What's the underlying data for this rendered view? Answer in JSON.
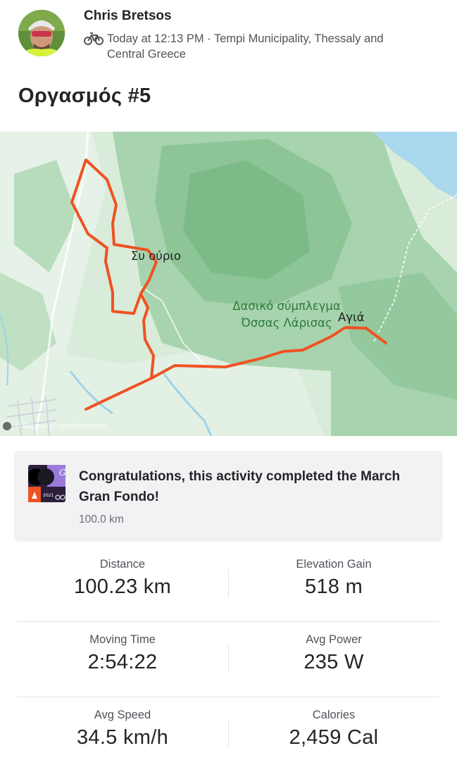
{
  "athlete": {
    "name": "Chris Bretsos",
    "timestamp": "Today at 12:13 PM",
    "location": "Tempi Municipality, Thessaly and Central Greece"
  },
  "activity": {
    "title": "Οργασμός #5",
    "type_icon": "bike-icon"
  },
  "map": {
    "labels": {
      "forest": "Δασικό σύμπλεγμα Όσσας Λάρισας",
      "town1": "Συ ούριο",
      "town2": "Αγιά"
    },
    "attribution": "© Mapbox © OpenStreetMap",
    "route_color": "#f05222"
  },
  "challenge": {
    "message": "Congratulations, this activity completed the March Gran Fondo!",
    "detail": "100.0 km",
    "badge_text": "G",
    "badge_year": "2021"
  },
  "stats": [
    {
      "label": "Distance",
      "value": "100.23 km"
    },
    {
      "label": "Elevation Gain",
      "value": "518 m"
    },
    {
      "label": "Moving Time",
      "value": "2:54:22"
    },
    {
      "label": "Avg Power",
      "value": "235 W"
    },
    {
      "label": "Avg Speed",
      "value": "34.5 km/h"
    },
    {
      "label": "Calories",
      "value": "2,459 Cal"
    }
  ]
}
